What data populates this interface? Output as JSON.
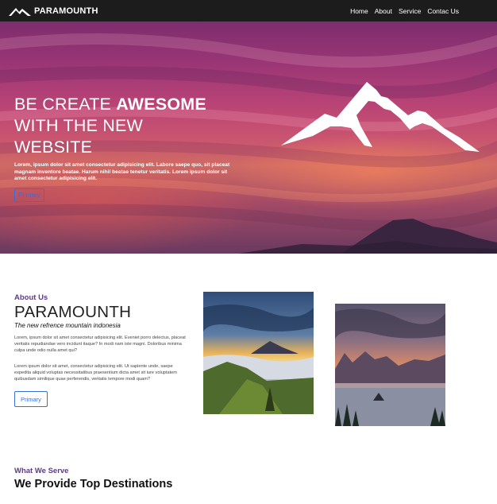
{
  "navbar": {
    "brand": "PARAMOUNTH",
    "brand_icon": "mountain-logo-icon",
    "links": [
      "Home",
      "About",
      "Service",
      "Contac Us"
    ]
  },
  "hero": {
    "title_line1_prefix": "BE CREATE ",
    "title_line1_bold": "AWESOME",
    "title_line2": "WITH THE NEW",
    "title_line3": "WEBSITE",
    "text": "Lorem, ipsum dolor sit amet consectetur adipisicing elit. Labore saepe quo, sit placeat magnam inventore beatae. Harum nihil beatae tenetur veritatis. Lorem ipsum dolor sit amet consectetur adipisicing elit.",
    "button": "Primary",
    "icon": "mountain-icon"
  },
  "about": {
    "kicker": "About Us",
    "title": "PARAMOUNTH",
    "subtitle": "The new refrence mountain indonesia",
    "p1": "Lorem, ipsum dolor sit amet consectetur adipisicing elit. Eveniet porro delectus, placeat veritatis repudiandae vero incidunt itaque? In modi nam iste magni. Doloribus minima culpa unde odio nulla amet qui?",
    "p2": "Lorem ipsum dolor sit amet, consectetur adipisicing elit. Ut sapiente unde, saepe expedita aliquid voluptas necessitatibus praesentium dicta amet sit iure voluptatem quibusdam similique quae perferendis, veritatis tempore modi quam?",
    "button": "Primary"
  },
  "serve": {
    "kicker": "What We Serve",
    "title": "We Provide Top Destinations"
  },
  "colors": {
    "navbar": "#1c1c1c",
    "accent_purple": "#5d3b85",
    "button_blue": "#3a6fd8"
  }
}
